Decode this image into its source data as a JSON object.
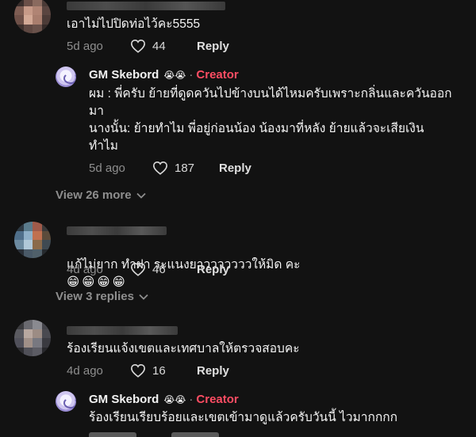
{
  "comments": [
    {
      "text": "เอาไม่ไปปิดท่อไว้คะ5555",
      "time": "5d ago",
      "likes": "44",
      "reply_label": "Reply"
    },
    {
      "author": "GM Skebord",
      "author_emoji": "😭😭",
      "creator_badge": "Creator",
      "separator": "·",
      "text": "ผม : พี่ครับ ย้ายที่ดูดควันไปข้างบนได้ไหมครับเพราะกลิ่นและควันออก\nมา\nนางนั้น: ย้ายทำไม พี่อยู่ก่อนน้อง น้องมาที่หลัง ย้ายแล้วจะเสียเงิน\nทำไม",
      "time": "5d ago",
      "likes": "187",
      "reply_label": "Reply"
    },
    {
      "text": "แก้ไม่ยาก ทำฝา ระแนงยาวววววววให้มิด คะ",
      "emoji": "😁😁😁😁",
      "time": "4d ago",
      "likes": "46",
      "reply_label": "Reply"
    },
    {
      "text": "ร้องเรียนแจ้งเขตและเทศบาลให้ตรวจสอบคะ",
      "time": "4d ago",
      "likes": "16",
      "reply_label": "Reply"
    },
    {
      "author": "GM Skebord",
      "author_emoji": "😭😭",
      "creator_badge": "Creator",
      "separator": "·",
      "text": "ร้องเรียนเรียบร้อยและเขตเข้ามาดูแล้วครับวันนี้ ไวมากกกก"
    }
  ],
  "view_more_replies": "View 26 more",
  "view_replies": "View 3 replies",
  "icons": [
    "heart-icon",
    "chevron-down-icon"
  ],
  "colors": {
    "background": "#121212",
    "creator_badge": "#ff4d63",
    "muted_text": "#8e8e8e"
  }
}
